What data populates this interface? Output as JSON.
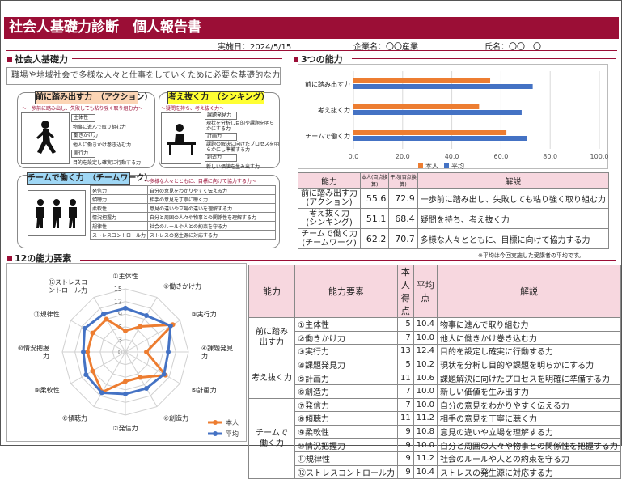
{
  "header": {
    "title": "社会人基礎力診断　個人報告書",
    "date_label": "実施日：",
    "date_value": "2024/5/15",
    "company_label": "企業名：",
    "company_value": "〇〇産業",
    "name_label": "氏名：",
    "name_value": "〇〇　〇"
  },
  "sections": {
    "basic": "社会人基礎力",
    "three": "3つの能力",
    "twelve": "12の能力要素"
  },
  "basic": {
    "description": "職場や地域社会で多様な人々と仕事をしていくために必要な基礎的な力",
    "groups": [
      {
        "label": "前に踏み出す力　（アクション）",
        "subtitle": "～一歩前に踏み出し、失敗しても粘り強く取り組む力～",
        "items": [
          {
            "name": "主体性",
            "desc": "物事に進んで取り組む力"
          },
          {
            "name": "働きかけ力",
            "desc": "他人に働きかけ巻き込む力"
          },
          {
            "name": "実行力",
            "desc": "目的を設定し確実に行動する力"
          }
        ]
      },
      {
        "label": "考え抜く力　（シンキング）",
        "subtitle": "～疑問を持ち、考え抜く力～",
        "items": [
          {
            "name": "課題発見力",
            "desc1": "現状を分析し目的や課題を明ら",
            "desc2": "かにする力"
          },
          {
            "name": "計画力",
            "desc1": "課題の解決に向けたプロセスを明",
            "desc2": "らかにし準備する力"
          },
          {
            "name": "創造力",
            "desc": "新しい価値を生み出す力"
          }
        ]
      },
      {
        "label": "チームで働く力　（チームワーク）",
        "subtitle": "～多様な人々とともに、目標に向けて協力する力～",
        "items": [
          {
            "name": "発信力",
            "desc": "自分の意見をわかりやすく伝える力"
          },
          {
            "name": "傾聴力",
            "desc": "相手の意見を丁寧に聴く力"
          },
          {
            "name": "柔軟性",
            "desc": "意見の違いや立場の違いを理解する力"
          },
          {
            "name": "情況把握力",
            "desc": "自分と周囲の人々や物事との関係性を理解する力"
          },
          {
            "name": "規律性",
            "desc": "社会のルールや人との約束を守る力"
          },
          {
            "name": "ストレスコントロール力",
            "desc": "ストレスの発生源に対応する力"
          }
        ]
      }
    ]
  },
  "chart_data": [
    {
      "type": "bar",
      "orientation": "horizontal",
      "categories": [
        "前に踏み出す力",
        "考え抜く力",
        "チームで働く力"
      ],
      "series": [
        {
          "name": "本人",
          "values": [
            55.6,
            51.1,
            62.2
          ],
          "color": "#ed7d31"
        },
        {
          "name": "平均",
          "values": [
            72.9,
            68.4,
            70.7
          ],
          "color": "#4472c4"
        }
      ],
      "xlim": [
        0,
        100
      ],
      "xticks": [
        "0.0",
        "20.0",
        "40.0",
        "60.0",
        "80.0",
        "100.0"
      ],
      "grid": true,
      "legend_placement": "bottom"
    },
    {
      "type": "radar",
      "categories": [
        "①主体性",
        "②働きかけ力",
        "③実行力",
        "④課題発見力",
        "⑤計画力",
        "⑥創造力",
        "⑦発信力",
        "⑧傾聴力",
        "⑨柔軟性",
        "⑩情況把握力",
        "⑪規律性",
        "⑫ストレスコントロール力"
      ],
      "category_labels": [
        [
          "①主体性"
        ],
        [
          "②働きかけ力"
        ],
        [
          "③実行力"
        ],
        [
          "④課題発見",
          "力"
        ],
        [
          "⑤計画力"
        ],
        [
          "⑥創造力"
        ],
        [
          "⑦発信力"
        ],
        [
          "⑧傾聴力"
        ],
        [
          "⑨柔軟性"
        ],
        [
          "⑩情況把握",
          "力"
        ],
        [
          "⑪規律性"
        ],
        [
          "⑫ストレスコ",
          "ントロール力"
        ]
      ],
      "series": [
        {
          "name": "本人",
          "values": [
            5,
            7,
            13,
            5,
            11,
            7,
            7,
            11,
            9,
            9,
            9,
            9
          ],
          "color": "#ed7d31"
        },
        {
          "name": "平均",
          "values": [
            10.4,
            10.0,
            12.4,
            10.2,
            10.6,
            10.0,
            10.0,
            11.2,
            10.8,
            10.0,
            11.2,
            10.4
          ],
          "color": "#4472c4"
        }
      ],
      "rlim": [
        0,
        15
      ],
      "rticks": [
        "0",
        "3",
        "6",
        "9",
        "12",
        "15"
      ],
      "legend_placement": "bottom-right"
    }
  ],
  "three_table": {
    "headers": [
      "能力",
      "本人(百点換算)",
      "平均(百点換算)",
      "解説"
    ],
    "rows": [
      {
        "ability": [
          "前に踏み出す力",
          "(アクション)"
        ],
        "self": "55.6",
        "avg": "72.9",
        "desc": "一歩前に踏み出し、失敗しても粘り強く取り組む力"
      },
      {
        "ability": [
          "考え抜く力",
          "(シンキング)"
        ],
        "self": "51.1",
        "avg": "68.4",
        "desc": "疑問を持ち、考え抜く力"
      },
      {
        "ability": [
          "チームで働く力",
          "(チームワーク)"
        ],
        "self": "62.2",
        "avg": "70.7",
        "desc": "多様な人々とともに、目標に向けて協力する力"
      }
    ],
    "note": "※平均は今回実施した受講者の平均です。"
  },
  "twelve_table": {
    "headers": [
      "能力",
      "能力要素",
      "本人得点",
      "平均点",
      "解説"
    ],
    "groups": [
      {
        "ability": [
          "前に踏み",
          "出す力"
        ],
        "rows": [
          {
            "element": "①主体性",
            "self": "5",
            "avg": "10.4",
            "desc": "物事に進んで取り組む力"
          },
          {
            "element": "②働きかけ力",
            "self": "7",
            "avg": "10.0",
            "desc": "他人に働きかけ巻き込む力"
          },
          {
            "element": "③実行力",
            "self": "13",
            "avg": "12.4",
            "desc": "目的を設定し確実に行動する力"
          }
        ]
      },
      {
        "ability": [
          "考え抜く力"
        ],
        "rows": [
          {
            "element": "④課題発見力",
            "self": "5",
            "avg": "10.2",
            "desc": "現状を分析し目的や課題を明らかにする力"
          },
          {
            "element": "⑤計画力",
            "self": "11",
            "avg": "10.6",
            "desc": "課題解決に向けたプロセスを明確に準備する力"
          },
          {
            "element": "⑥創造力",
            "self": "7",
            "avg": "10.0",
            "desc": "新しい価値を生み出す力"
          }
        ]
      },
      {
        "ability": [
          "チームで",
          "働く力"
        ],
        "rows": [
          {
            "element": "⑦発信力",
            "self": "7",
            "avg": "10.0",
            "desc": "自分の意見をわかりやすく伝える力"
          },
          {
            "element": "⑧傾聴力",
            "self": "11",
            "avg": "11.2",
            "desc": "相手の意見を丁寧に聴く力"
          },
          {
            "element": "⑨柔軟性",
            "self": "9",
            "avg": "10.8",
            "desc": "意見の違いや立場を理解する力"
          },
          {
            "element": "⑩情況把握力",
            "self": "9",
            "avg": "10.0",
            "desc": "自分と周囲の人々や物事との関係性を把握する力"
          },
          {
            "element": "⑪規律性",
            "self": "9",
            "avg": "11.2",
            "desc": "社会のルールや人との約束を守る力"
          },
          {
            "element": "⑫ストレスコントロール力",
            "self": "9",
            "avg": "10.4",
            "desc": "ストレスの発生源に対応する力"
          }
        ]
      }
    ]
  }
}
